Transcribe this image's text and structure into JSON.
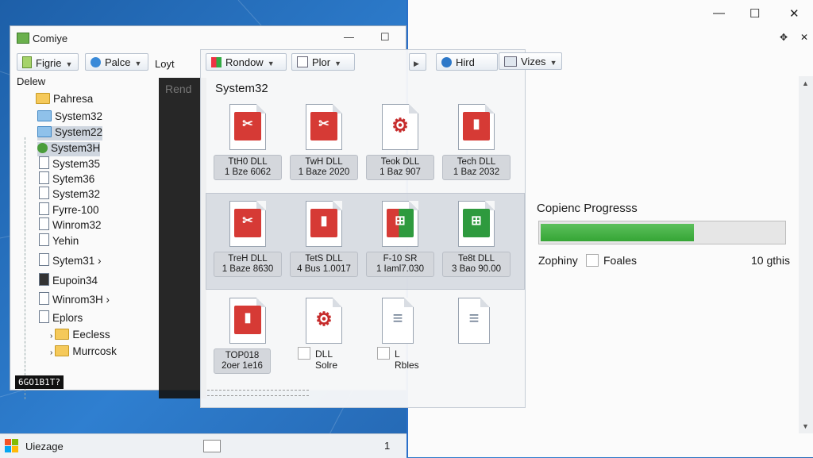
{
  "explorer": {
    "title": "Comiye",
    "controls": {
      "minimize": "—",
      "maximize": "☐"
    },
    "toolbar": {
      "btn1": "Figrie",
      "btn2": "Palce",
      "plain": "Loyt"
    },
    "tree_root": "Delew",
    "tree": [
      {
        "label": "Pahresa"
      },
      {
        "label": "System32"
      },
      {
        "label": "System22"
      },
      {
        "label": "System3H"
      },
      {
        "label": "System35"
      },
      {
        "label": "Sytem36"
      },
      {
        "label": "System32"
      },
      {
        "label": "Fyrre-100"
      },
      {
        "label": "Winrom32"
      },
      {
        "label": "Yehin"
      },
      {
        "label": "Sytem31 ›"
      },
      {
        "label": "Eupoin34"
      },
      {
        "label": "Winrom3H ›"
      },
      {
        "label": "Eplors"
      },
      {
        "label": "Eecless"
      },
      {
        "label": "Murrcosk"
      }
    ],
    "readout": "6GO1B1T?"
  },
  "overlay": {
    "text": "Rend"
  },
  "file_panel": {
    "toolbar": {
      "btn1": "Rondow",
      "btn2": "Plor",
      "btn3": "Hird",
      "btn4": "Vizes"
    },
    "heading": "System32",
    "files": [
      {
        "name": "TtH0 DLL",
        "sub": "1 Bze 6062",
        "color": "#d63a35",
        "glyph": "✂"
      },
      {
        "name": "TwH DLL",
        "sub": "1 Baze 2020",
        "color": "#d63a35",
        "glyph": "✂"
      },
      {
        "name": "Teok DLL",
        "sub": "1 Baz 907",
        "color": "#ffffff",
        "glyph": "⚙"
      },
      {
        "name": "Tech DLL",
        "sub": "1 Baz 2032",
        "color": "#d63a35",
        "glyph": "▮"
      },
      {
        "name": "TreH DLL",
        "sub": "1 Baze 8630",
        "color": "#d63a35",
        "glyph": "✂"
      },
      {
        "name": "TetS DLL",
        "sub": "4 Bus 1.0017",
        "color": "#d63a35",
        "glyph": "▮"
      },
      {
        "name": "F-10 SR",
        "sub": "1 Iaml7.030",
        "color": "#2e9a3e",
        "glyph": "⊞"
      },
      {
        "name": "Te8t DLL",
        "sub": "3 Bao 90.00",
        "color": "#2e9a3e",
        "glyph": "⊞"
      },
      {
        "name": "TOP018",
        "sub": "2oer 1e16",
        "color": "#d63a35",
        "glyph": "▮"
      },
      {
        "name": "DLL",
        "sub": "Solre",
        "color": "#ffffff",
        "glyph": "⚙"
      },
      {
        "name": "L",
        "sub": "Rbles",
        "color": "#ffffff",
        "glyph": "≡"
      },
      {
        "name": "",
        "sub": "",
        "color": "#ffffff",
        "glyph": "≡"
      }
    ]
  },
  "copy_dialog": {
    "controls": {
      "minimize": "—",
      "maximize": "☐",
      "close": "✕"
    },
    "title": "Copienc Progresss",
    "progress": 0.63,
    "left_label": "Zophiny",
    "mid_label": "Foales",
    "right_label": "10 gthis",
    "accent": "#3aa83a"
  },
  "taskbar": {
    "label": "Uiezage",
    "page": "1"
  }
}
